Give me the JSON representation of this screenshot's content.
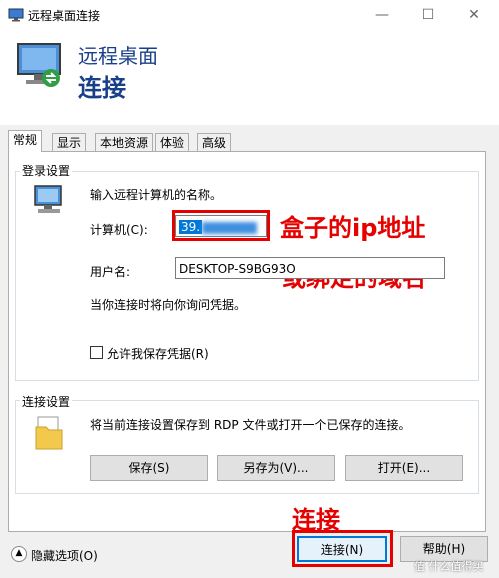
{
  "window": {
    "title": "远程桌面连接",
    "minimize_glyph": "—",
    "maximize_glyph": "☐",
    "close_glyph": "✕"
  },
  "header": {
    "line1": "远程桌面",
    "line2": "连接"
  },
  "tabs": [
    {
      "label": "常规"
    },
    {
      "label": "显示"
    },
    {
      "label": "本地资源"
    },
    {
      "label": "体验"
    },
    {
      "label": "高级"
    }
  ],
  "login": {
    "group_label": "登录设置",
    "prompt": "输入远程计算机的名称。",
    "computer_label": "计算机(C):",
    "computer_value": "39.",
    "username_label": "用户名:",
    "username_value": "DESKTOP-S9BG93O",
    "note": "当你连接时将向你询问凭据。",
    "save_creds_label": "允许我保存凭据(R)",
    "save_creds_checked": false
  },
  "connection": {
    "group_label": "连接设置",
    "description": "将当前连接设置保存到 RDP 文件或打开一个已保存的连接。",
    "save_button": "保存(S)",
    "save_as_button": "另存为(V)...",
    "open_button": "打开(E)..."
  },
  "footer": {
    "hide_options": "隐藏选项(O)",
    "connect_button": "连接(N)",
    "help_button": "帮助(H)"
  },
  "annotations": {
    "line1": "盒子的ip地址",
    "line2": "或绑定的域名",
    "connect": "连接"
  },
  "watermark": "值 什么值得买",
  "colors": {
    "accent": "#1a3f8a",
    "annotation": "#e60000",
    "selection": "#0078d7"
  }
}
